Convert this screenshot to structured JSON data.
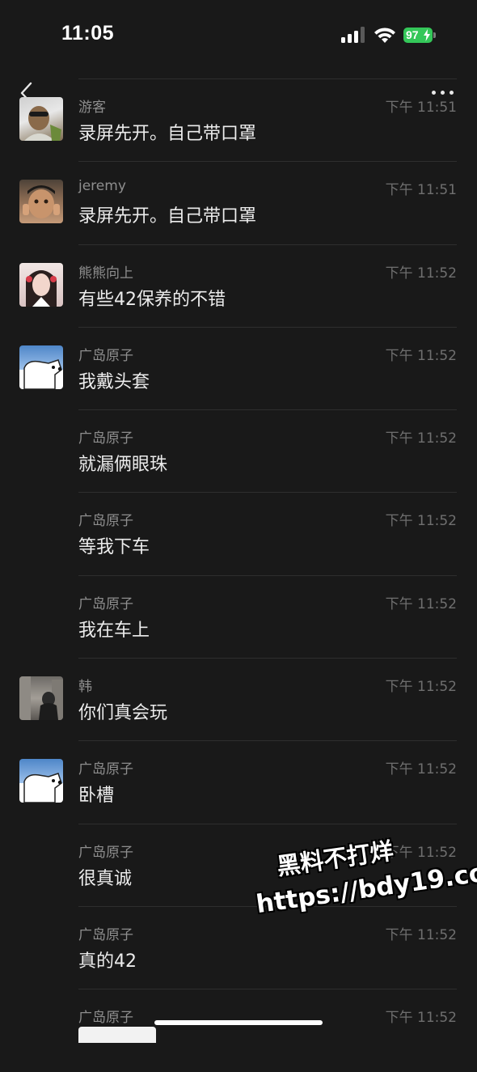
{
  "status_bar": {
    "time": "11:05",
    "battery": "97",
    "battery_color": "#34c759"
  },
  "nav": {
    "back_icon": "chevron-left-icon",
    "more_icon": "ellipsis-icon"
  },
  "messages": [
    {
      "sender": "游客",
      "time": "下午 11:51",
      "text": "录屏先开。自己带口罩",
      "avatar": "youke"
    },
    {
      "sender": "jeremy",
      "time": "下午 11:51",
      "text": "录屏先开。自己带口罩",
      "avatar": "jeremy"
    },
    {
      "sender": "熊熊向上",
      "time": "下午 11:52",
      "text": "有些42保养的不错",
      "avatar": "xiong"
    },
    {
      "sender": "广岛原子",
      "time": "下午 11:52",
      "text": "我戴头套",
      "avatar": "guangdao"
    },
    {
      "sender": "广岛原子",
      "time": "下午 11:52",
      "text": "就漏俩眼珠",
      "avatar": ""
    },
    {
      "sender": "广岛原子",
      "time": "下午 11:52",
      "text": "等我下车",
      "avatar": ""
    },
    {
      "sender": "广岛原子",
      "time": "下午 11:52",
      "text": "我在车上",
      "avatar": ""
    },
    {
      "sender": "韩",
      "time": "下午 11:52",
      "text": "你们真会玩",
      "avatar": "han"
    },
    {
      "sender": "广岛原子",
      "time": "下午 11:52",
      "text": "卧槽",
      "avatar": "guangdao"
    },
    {
      "sender": "广岛原子",
      "time": "下午 11:52",
      "text": "很真诚",
      "avatar": ""
    },
    {
      "sender": "广岛原子",
      "time": "下午 11:52",
      "text": "真的42",
      "avatar": ""
    },
    {
      "sender": "广岛原子",
      "time": "下午 11:52",
      "text": "",
      "avatar": ""
    }
  ],
  "watermark": {
    "line1": "黑料不打烊",
    "line2": "https://bdy19.co"
  }
}
